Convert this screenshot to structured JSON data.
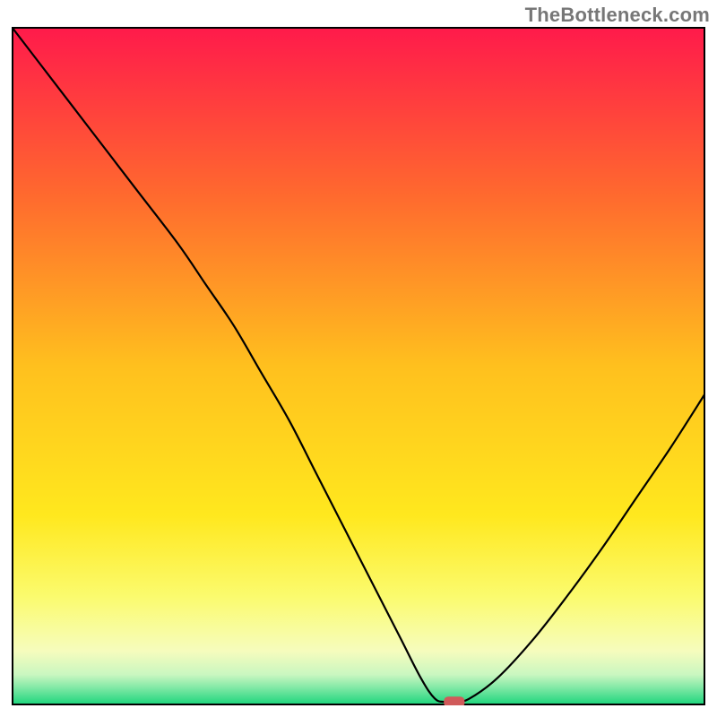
{
  "attribution": "TheBottleneck.com",
  "chart_data": {
    "type": "line",
    "title": "",
    "xlabel": "",
    "ylabel": "",
    "xlim": [
      0,
      100
    ],
    "ylim": [
      0,
      100
    ],
    "grid": false,
    "legend": false,
    "background_gradient_stops": [
      {
        "offset": 0.0,
        "color": "#ff1a4b"
      },
      {
        "offset": 0.25,
        "color": "#ff6a2e"
      },
      {
        "offset": 0.5,
        "color": "#ffc01e"
      },
      {
        "offset": 0.72,
        "color": "#ffe81e"
      },
      {
        "offset": 0.84,
        "color": "#fbfb6e"
      },
      {
        "offset": 0.92,
        "color": "#f6fcbd"
      },
      {
        "offset": 0.955,
        "color": "#c9f7c0"
      },
      {
        "offset": 0.975,
        "color": "#7de8a4"
      },
      {
        "offset": 1.0,
        "color": "#18d47a"
      }
    ],
    "series": [
      {
        "name": "bottleneck-curve",
        "color": "#000000",
        "x": [
          0.0,
          6.0,
          12.0,
          18.0,
          24.0,
          28.0,
          32.0,
          36.0,
          40.0,
          44.0,
          48.0,
          52.0,
          56.0,
          59.0,
          61.0,
          62.5,
          64.0,
          66.0,
          70.0,
          75.0,
          80.0,
          85.0,
          90.0,
          95.0,
          100.0
        ],
        "y": [
          100.0,
          92.0,
          84.0,
          76.0,
          68.0,
          62.0,
          56.0,
          49.0,
          42.0,
          34.0,
          26.0,
          18.0,
          10.0,
          4.0,
          1.0,
          0.5,
          0.5,
          1.0,
          4.0,
          9.5,
          16.0,
          23.0,
          30.5,
          38.0,
          46.0
        ]
      }
    ],
    "marker": {
      "name": "optimum-marker",
      "x": 63.8,
      "y": 0.5,
      "width_x": 3.0,
      "color": "#d05a5a"
    },
    "axes": {
      "frame_color": "#000000",
      "frame_width": 2
    }
  }
}
